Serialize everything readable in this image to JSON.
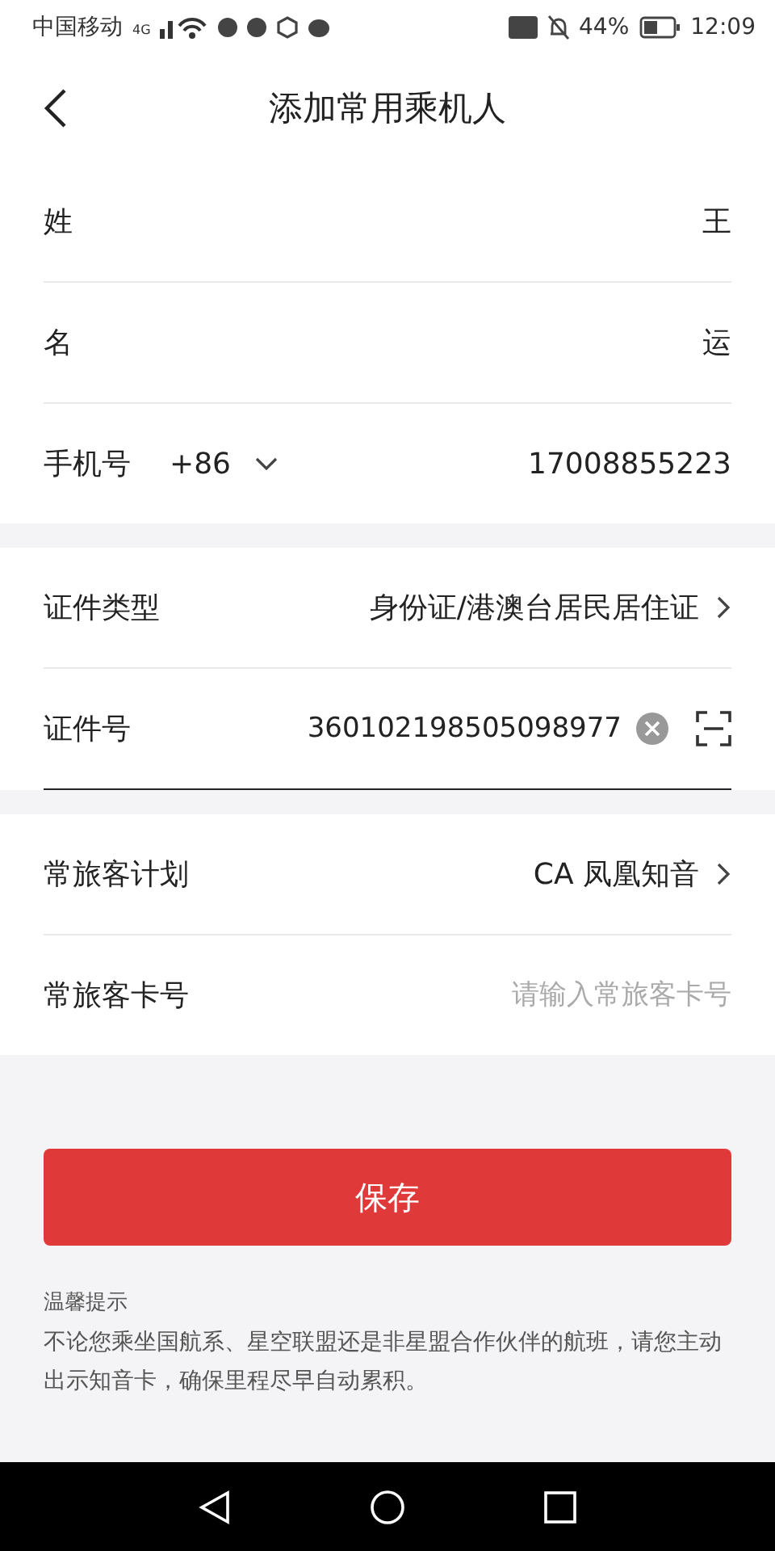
{
  "status_bar": {
    "carrier": "中国移动",
    "network": "4G",
    "battery": "44%",
    "time": "12:09"
  },
  "header": {
    "title": "添加常用乘机人"
  },
  "sections": [
    {
      "rows": [
        {
          "kind": "text",
          "label": "姓",
          "value": "王"
        },
        {
          "kind": "text",
          "label": "名",
          "value": "运"
        },
        {
          "kind": "phone",
          "label": "手机号",
          "prefix": "+86",
          "value": "17008855223"
        }
      ]
    },
    {
      "rows": [
        {
          "kind": "select",
          "label": "证件类型",
          "value": "身份证/港澳台居民居住证"
        },
        {
          "kind": "input",
          "label": "证件号",
          "value": "360102198505098977",
          "focused": true
        }
      ]
    },
    {
      "rows": [
        {
          "kind": "select",
          "label": "常旅客计划",
          "value": "CA 凤凰知音"
        },
        {
          "kind": "placeholder",
          "label": "常旅客卡号",
          "placeholder": "请输入常旅客卡号"
        }
      ]
    }
  ],
  "save_button": "保存",
  "tips": {
    "title": "温馨提示",
    "text": "不论您乘坐国航系、星空联盟还是非星盟合作伙伴的航班，请您主动出示知音卡，确保里程尽早自动累积。"
  }
}
